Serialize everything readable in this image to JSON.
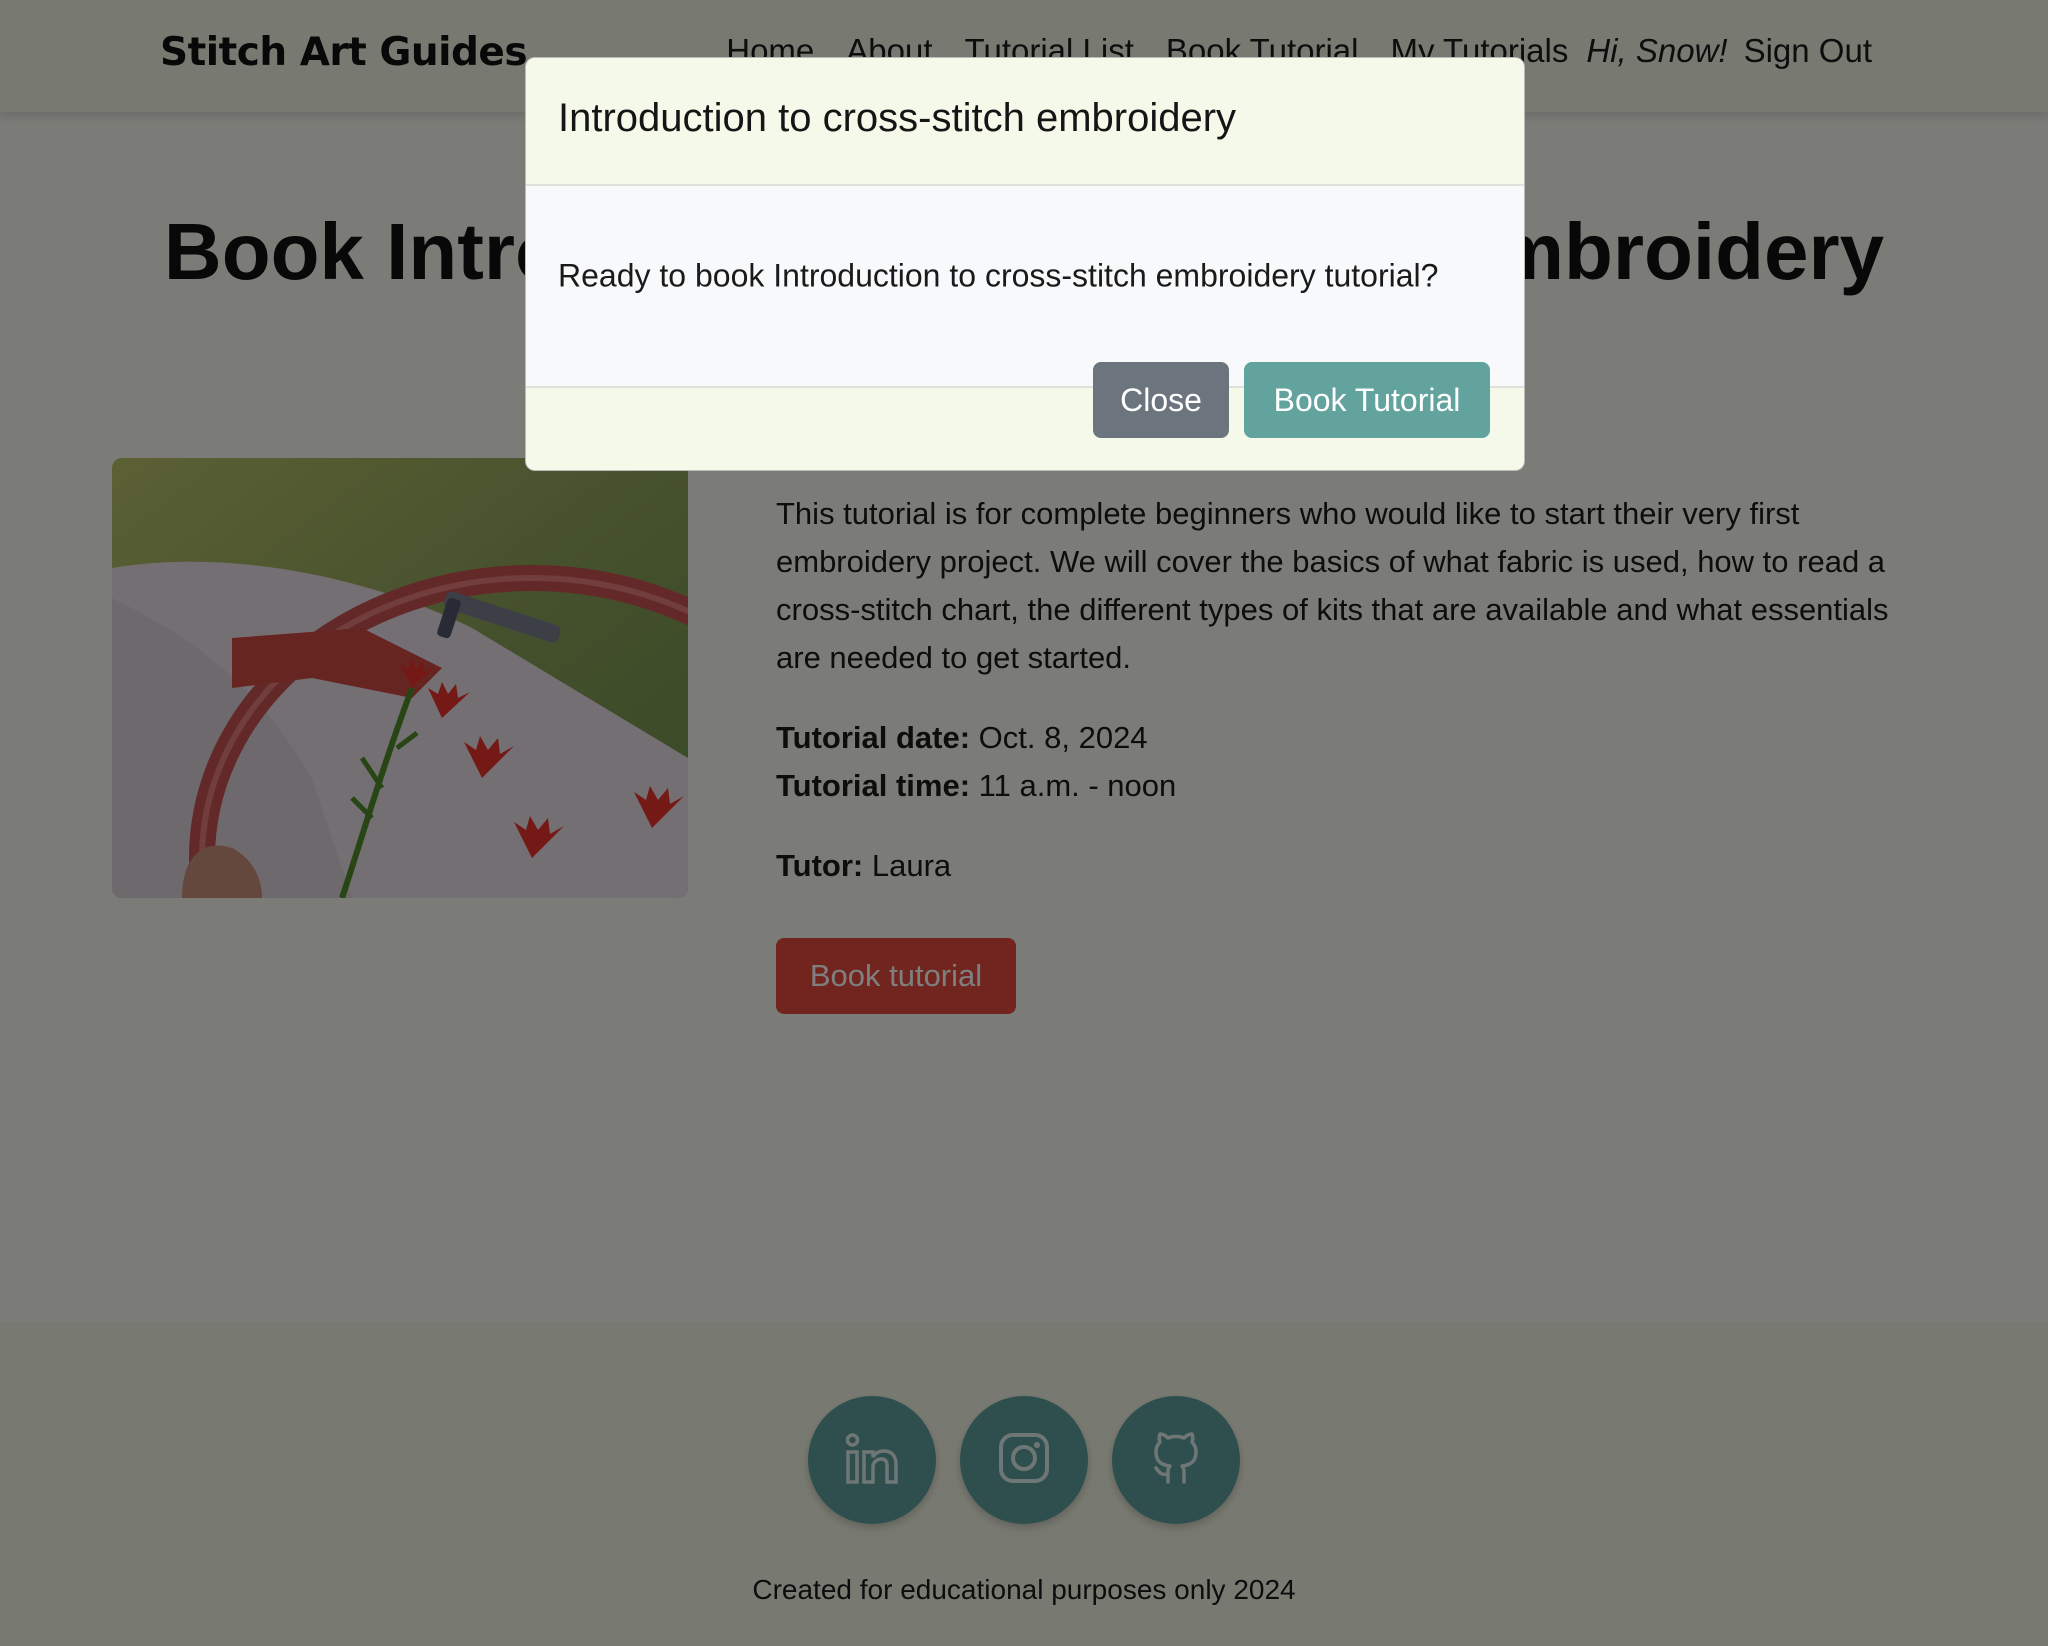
{
  "brand": "Stitch Art Guides",
  "nav": {
    "items": [
      "Home",
      "About",
      "Tutorial List",
      "Book Tutorial",
      "My Tutorials"
    ],
    "greeting": "Hi, Snow!",
    "signout": "Sign Out"
  },
  "page": {
    "title": "Book Introduction to cross-stitch embroidery"
  },
  "tutorial": {
    "description": "This tutorial is for complete beginners who would like to start their very first embroidery project. We will cover the basics of what fabric is used, how to read a cross-stitch chart, the different types of kits that are available and what essentials are needed to get started.",
    "date_label": "Tutorial date:",
    "date_value": "Oct. 8, 2024",
    "time_label": "Tutorial time:",
    "time_value": "11 a.m. - noon",
    "tutor_label": "Tutor:",
    "tutor_value": "Laura",
    "book_button": "Book tutorial"
  },
  "footer": {
    "socials": [
      "linkedin-icon",
      "instagram-icon",
      "github-icon"
    ],
    "text": "Created for educational purposes only 2024"
  },
  "modal": {
    "title": "Introduction to cross-stitch embroidery",
    "body": "Ready to book Introduction to cross-stitch embroidery tutorial?",
    "close_button": "Close",
    "confirm_button": "Book Tutorial"
  },
  "colors": {
    "page_bg": "#f7f9ef",
    "accent_teal": "#5c9e9a",
    "book_red": "#e34b3c",
    "close_gray": "#6c757d"
  }
}
